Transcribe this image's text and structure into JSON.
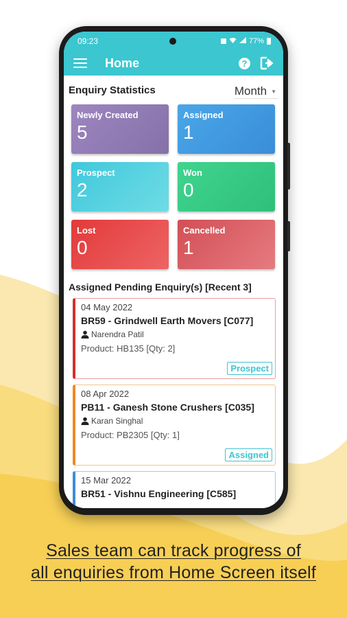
{
  "status_bar": {
    "time": "09:23",
    "battery": "77%"
  },
  "app_bar": {
    "title": "Home"
  },
  "stats": {
    "title": "Enquiry Statistics",
    "period": "Month",
    "tiles": [
      {
        "label": "Newly Created",
        "value": "5",
        "color_from": "#9e86c0",
        "color_to": "#8571a8"
      },
      {
        "label": "Assigned",
        "value": "1",
        "color_from": "#4aa6e8",
        "color_to": "#3a8ed8"
      },
      {
        "label": "Prospect",
        "value": "2",
        "color_from": "#40c8dc",
        "color_to": "#6edce4"
      },
      {
        "label": "Won",
        "value": "0",
        "color_from": "#3fd48f",
        "color_to": "#2fc07a"
      },
      {
        "label": "Lost",
        "value": "0",
        "color_from": "#e23a3a",
        "color_to": "#ee6464"
      },
      {
        "label": "Cancelled",
        "value": "1",
        "color_from": "#d24f55",
        "color_to": "#e57b80"
      }
    ]
  },
  "pending": {
    "title": "Assigned Pending Enquiry(s) [Recent 3]",
    "items": [
      {
        "date": "04 May 2022",
        "title": "BR59 - Grindwell Earth Movers [C077]",
        "person": "Narendra Patil",
        "product": "Product: HB135 [Qty: 2]",
        "status": "Prospect",
        "accent": "#d32f2f"
      },
      {
        "date": "08 Apr 2022",
        "title": "PB11 - Ganesh Stone Crushers [C035]",
        "person": "Karan Singhal",
        "product": "Product: PB2305 [Qty: 1]",
        "status": "Assigned",
        "accent": "#ef8a1e"
      },
      {
        "date": "15 Mar 2022",
        "title": "BR51 - Vishnu Engineering [C585]",
        "person": "",
        "product": "",
        "status": "",
        "accent": "#3a8ed8"
      }
    ]
  },
  "caption": {
    "line1": "Sales team can track progress of",
    "line2": "all enquiries from Home Screen itself"
  },
  "colors": {
    "primary": "#3cc6cf",
    "background_wave": "#f7cf55"
  }
}
